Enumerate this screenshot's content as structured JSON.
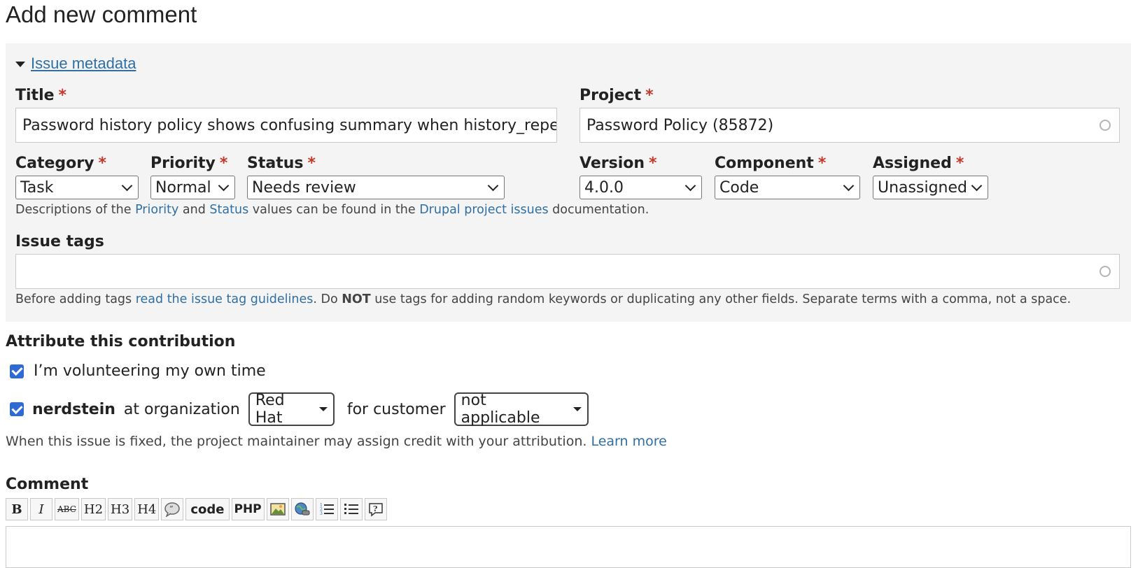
{
  "page": {
    "heading": "Add new comment"
  },
  "metadata": {
    "legend": "Issue metadata",
    "title": {
      "label": "Title",
      "required": "*",
      "value": "Password history policy shows confusing summary when history_repe"
    },
    "project": {
      "label": "Project",
      "required": "*",
      "value": "Password Policy (85872)"
    },
    "category": {
      "label": "Category",
      "required": "*",
      "value": "Task"
    },
    "priority": {
      "label": "Priority",
      "required": "*",
      "value": "Normal"
    },
    "status": {
      "label": "Status",
      "required": "*",
      "value": "Needs review"
    },
    "version": {
      "label": "Version",
      "required": "*",
      "value": "4.0.0"
    },
    "component": {
      "label": "Component",
      "required": "*",
      "value": "Code"
    },
    "assigned": {
      "label": "Assigned",
      "required": "*",
      "value": "Unassigned"
    },
    "desc": {
      "p1": "Descriptions of the ",
      "link1": "Priority",
      "p2": " and ",
      "link2": "Status",
      "p3": " values can be found in the ",
      "link3": "Drupal project issues",
      "p4": " documentation."
    },
    "tags": {
      "label": "Issue tags",
      "value": "",
      "help_p1": "Before adding tags ",
      "help_link": "read the issue tag guidelines",
      "help_p2": ". Do ",
      "help_bold": "NOT",
      "help_p3": " use tags for adding random keywords or duplicating any other fields. Separate terms with a comma, not a space."
    }
  },
  "attribution": {
    "heading": "Attribute this contribution",
    "volunteer_label": "I’m volunteering my own time",
    "volunteer_checked": true,
    "user_checked": true,
    "username": "nerdstein",
    "at_org_text": "at organization",
    "organization": "Red Hat",
    "for_customer_text": "for customer",
    "customer": "not applicable",
    "note": "When this issue is fixed, the project maintainer may assign credit with your attribution. ",
    "learn_more": "Learn more"
  },
  "comment": {
    "label": "Comment",
    "toolbar": {
      "bold": "B",
      "italic": "I",
      "strike": "ABC",
      "h2": "H2",
      "h3": "H3",
      "h4": "H4",
      "code": "code",
      "php": "PHP"
    },
    "value": ""
  },
  "colors": {
    "link": "#2f6fa3",
    "required": "#c5392b",
    "panel": "#f4f4f4",
    "checkbox": "#2d6ad3"
  }
}
